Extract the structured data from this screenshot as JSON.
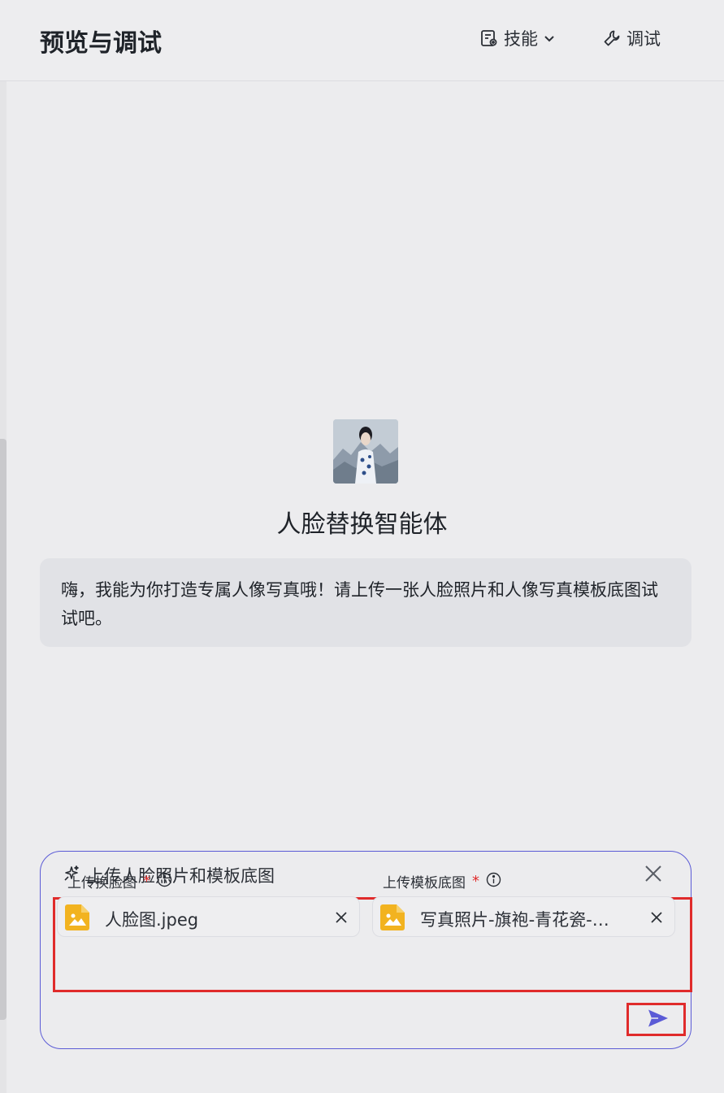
{
  "header": {
    "title": "预览与调试",
    "skills_label": "技能",
    "debug_label": "调试"
  },
  "agent": {
    "name": "人脸替换智能体",
    "greeting": "嗨，我能为你打造专属人像写真哦！请上传一张人脸照片和人像写真模板底图试试吧。"
  },
  "upload_panel": {
    "title": "上传人脸照片和模板底图",
    "fields": [
      {
        "label": "上传换脸图",
        "required_mark": "*",
        "file_name": "人脸图.jpeg"
      },
      {
        "label": "上传模板底图",
        "required_mark": "*",
        "file_name": "写真照片-旗袍-青花瓷-…"
      }
    ]
  },
  "colors": {
    "accent": "#5b5bd6",
    "highlight": "#e02b2b",
    "file_icon": "#f2b320",
    "background": "#ececee"
  },
  "icons": [
    "skills-icon",
    "chevron-down-icon",
    "wrench-icon",
    "sparkle-icon",
    "close-icon",
    "info-icon",
    "image-file-icon",
    "send-icon"
  ]
}
